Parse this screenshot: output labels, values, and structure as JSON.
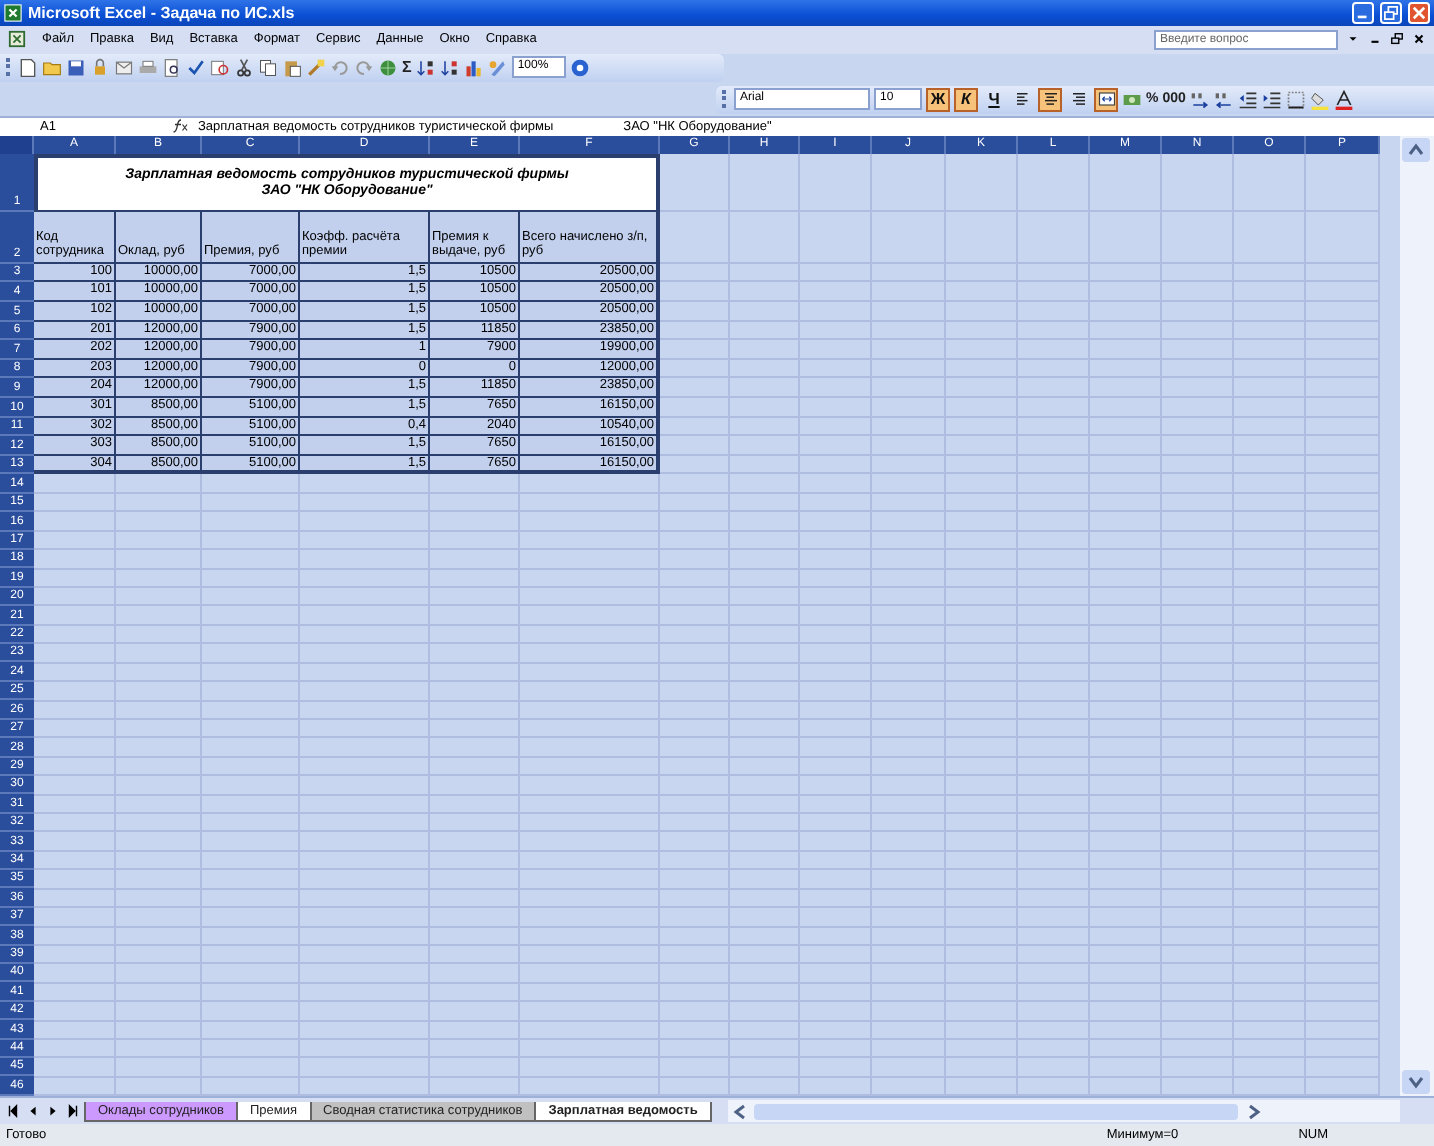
{
  "window": {
    "title": "Microsoft Excel - Задача по ИС.xls"
  },
  "menu": [
    "Файл",
    "Правка",
    "Вид",
    "Вставка",
    "Формат",
    "Сервис",
    "Данные",
    "Окно",
    "Справка"
  ],
  "help_box": {
    "placeholder": "Введите вопрос"
  },
  "standard_toolbar": {
    "autosum": "Σ",
    "zoom": "100%"
  },
  "format_toolbar": {
    "font": "Arial",
    "size": "10",
    "style_buttons": [
      {
        "label": "Ж",
        "kind": "bold",
        "selected": true
      },
      {
        "label": "К",
        "kind": "italic",
        "selected": true
      },
      {
        "label": "Ч",
        "kind": "underline",
        "selected": false
      }
    ],
    "align_buttons": [
      {
        "kind": "left",
        "selected": false
      },
      {
        "kind": "center",
        "selected": true
      },
      {
        "kind": "right",
        "selected": false
      },
      {
        "kind": "merge",
        "selected": true
      }
    ],
    "percent": "%",
    "thousands": "000"
  },
  "formula_bar": {
    "name_box": "A1",
    "lines": [
      "Зарплатная ведомость сотрудников туристической фирмы",
      "ЗАО \"НК Оборудование\""
    ]
  },
  "sheet": {
    "columns": [
      "A",
      "B",
      "C",
      "D",
      "E",
      "F",
      "G",
      "H",
      "I",
      "J",
      "K",
      "L",
      "M",
      "N",
      "O",
      "P"
    ],
    "row_numbers": [
      "1",
      "2",
      "3",
      "4",
      "5",
      "6",
      "7",
      "8",
      "9",
      "10",
      "11",
      "12",
      "13",
      "14",
      "15",
      "16",
      "17",
      "18",
      "19",
      "20",
      "21",
      "22",
      "23",
      "24",
      "25",
      "26",
      "27",
      "28",
      "29",
      "30",
      "31",
      "32",
      "33",
      "34",
      "35",
      "36",
      "37",
      "38",
      "39",
      "40",
      "41",
      "42",
      "43",
      "44",
      "45",
      "46"
    ],
    "title": [
      "Зарплатная ведомость сотрудников туристической фирмы",
      "ЗАО \"НК Оборудование\""
    ],
    "headers": [
      "Код сотрудника",
      "Оклад, руб",
      "Премия, руб",
      "Коэфф. расчёта премии",
      "Премия к выдаче, руб",
      "Всего начислено з/п, руб"
    ],
    "rows": [
      [
        "100",
        "10000,00",
        "7000,00",
        "1,5",
        "10500",
        "20500,00"
      ],
      [
        "101",
        "10000,00",
        "7000,00",
        "1,5",
        "10500",
        "20500,00"
      ],
      [
        "102",
        "10000,00",
        "7000,00",
        "1,5",
        "10500",
        "20500,00"
      ],
      [
        "201",
        "12000,00",
        "7900,00",
        "1,5",
        "11850",
        "23850,00"
      ],
      [
        "202",
        "12000,00",
        "7900,00",
        "1",
        "7900",
        "19900,00"
      ],
      [
        "203",
        "12000,00",
        "7900,00",
        "0",
        "0",
        "12000,00"
      ],
      [
        "204",
        "12000,00",
        "7900,00",
        "1,5",
        "11850",
        "23850,00"
      ],
      [
        "301",
        "8500,00",
        "5100,00",
        "1,5",
        "7650",
        "16150,00"
      ],
      [
        "302",
        "8500,00",
        "5100,00",
        "0,4",
        "2040",
        "10540,00"
      ],
      [
        "303",
        "8500,00",
        "5100,00",
        "1,5",
        "7650",
        "16150,00"
      ],
      [
        "304",
        "8500,00",
        "5100,00",
        "1,5",
        "7650",
        "16150,00"
      ]
    ]
  },
  "sheet_tabs": [
    {
      "label": "Оклады сотрудников",
      "color": "#cc99ff",
      "selected": false
    },
    {
      "label": "Премия",
      "color": "#ffffff",
      "selected": false
    },
    {
      "label": "Сводная статистика сотрудников",
      "color": "#c0c0c0",
      "selected": false
    },
    {
      "label": "Зарплатная ведомость",
      "color": "#ffffff",
      "selected": true
    }
  ],
  "status_bar": {
    "state": "Готово",
    "summary": "Минимум=0",
    "num": "NUM"
  }
}
